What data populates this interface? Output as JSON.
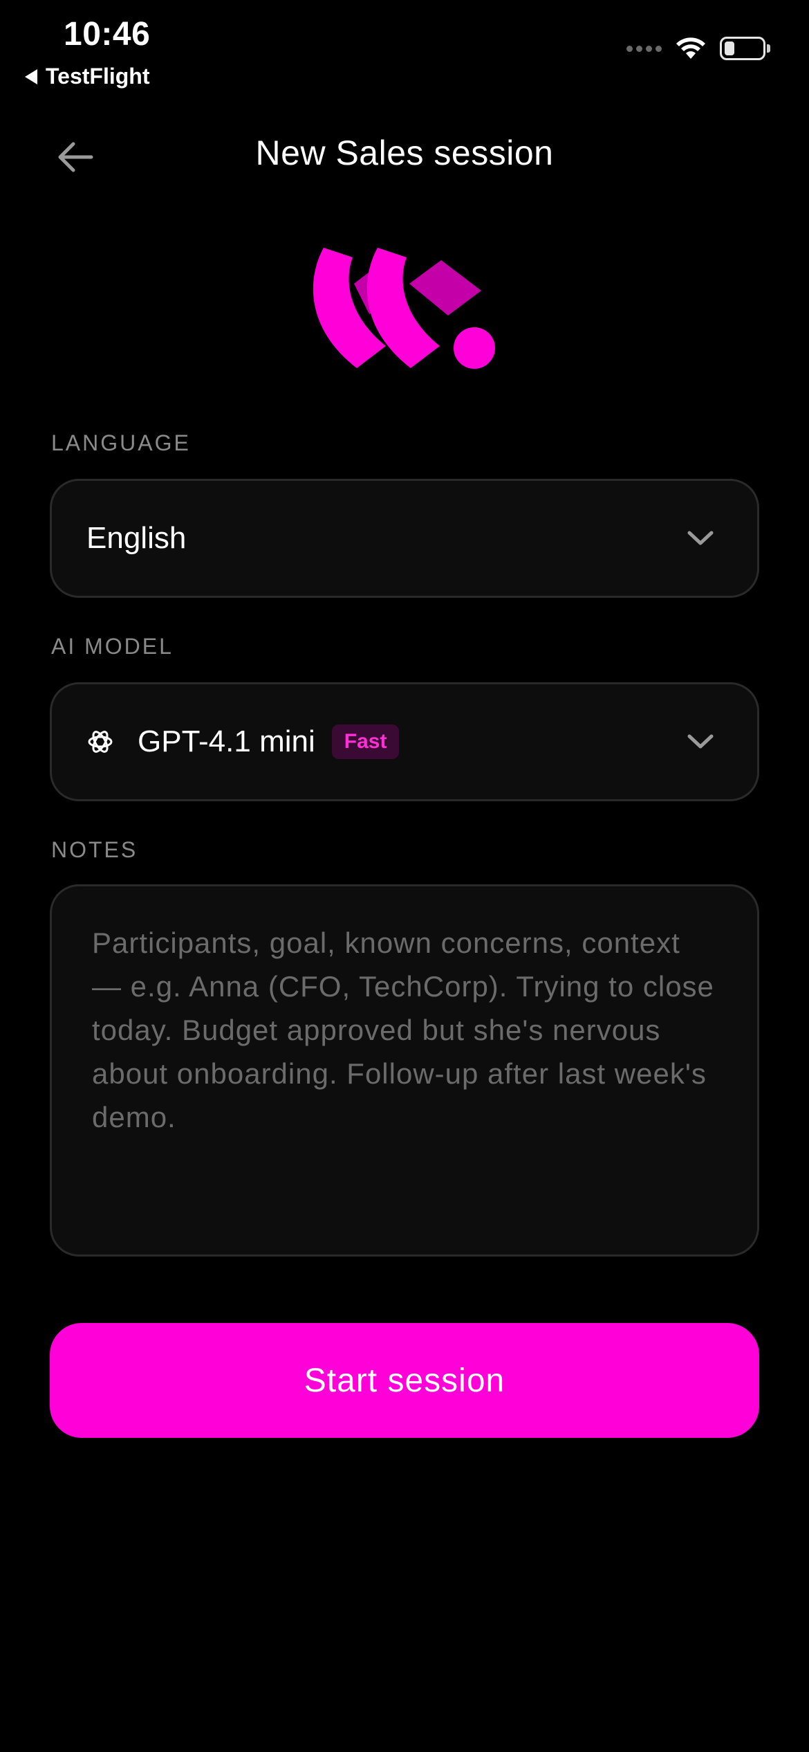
{
  "status_bar": {
    "time": "10:46",
    "back_app": "TestFlight"
  },
  "header": {
    "title": "New Sales session",
    "back_icon": "arrow-left-icon"
  },
  "logo": {
    "name": "brand-logo",
    "color": "#ff00d8"
  },
  "language": {
    "label": "LANGUAGE",
    "value": "English"
  },
  "ai_model": {
    "label": "AI MODEL",
    "value": "GPT-4.1 mini",
    "badge": "Fast",
    "icon": "openai-icon"
  },
  "notes": {
    "label": "NOTES",
    "placeholder": "Participants, goal, known concerns, context — e.g. Anna (CFO, TechCorp). Trying to close today. Budget approved but she's nervous about onboarding. Follow-up after last week's demo.",
    "value": ""
  },
  "actions": {
    "start_label": "Start session"
  },
  "colors": {
    "accent": "#ff00d8",
    "background": "#000000",
    "field_background": "#0d0d0d",
    "field_border": "#2a2a2a",
    "label": "#8a8a8a",
    "badge_background": "#3a0a34",
    "badge_text": "#ff2fd6"
  }
}
